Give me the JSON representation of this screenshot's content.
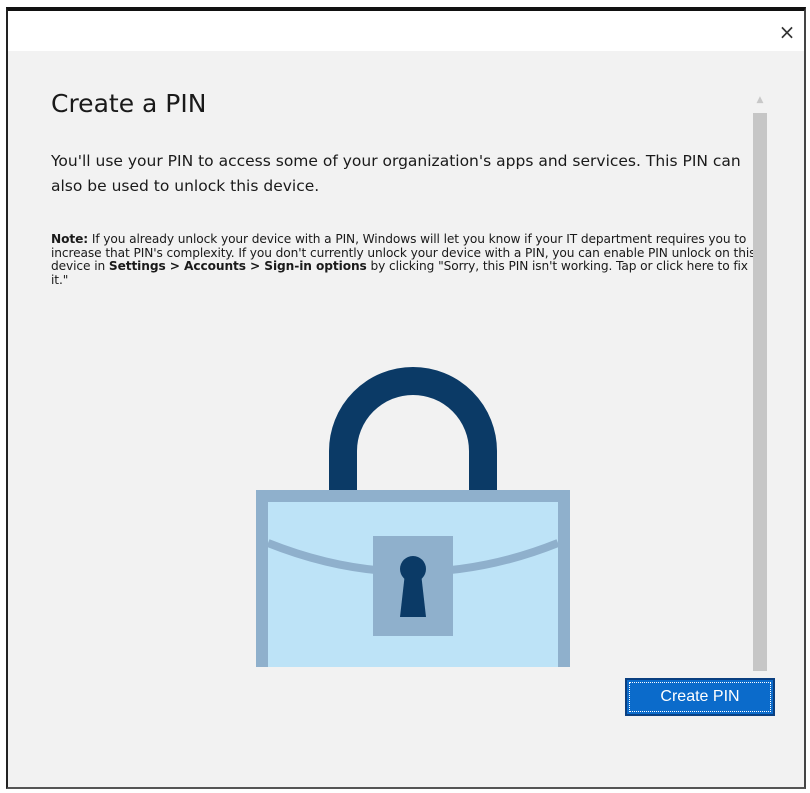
{
  "window": {
    "close_glyph": "×"
  },
  "dialog": {
    "title": "Create a PIN",
    "description": "You'll use your PIN to access some of your organization's apps and services. This PIN can also be used to unlock this device.",
    "note": {
      "label": "Note:",
      "text_part1": " If you already unlock your device with a PIN, Windows will let you know if your IT department requires you to increase that PIN's complexity. If you don't currently unlock your device with a PIN, you can enable PIN unlock on this device in ",
      "settings_path": "Settings > Accounts > Sign-in options",
      "text_part2": " by clicking \"Sorry, this PIN isn't working. Tap or click here to fix it.\""
    },
    "illustration_icon": "padlock-briefcase-icon",
    "primary_button_label": "Create PIN"
  },
  "colors": {
    "shackle": "#0b3a66",
    "body_fill": "#bde3f7",
    "body_border": "#8fb0cc",
    "keyhole_plate": "#8fb0cc",
    "keyhole": "#0b3a66",
    "button": "#0b6bcb",
    "background": "#f2f2f2"
  },
  "scrollbar": {
    "up_arrow": "▲",
    "down_arrow": "▼"
  }
}
